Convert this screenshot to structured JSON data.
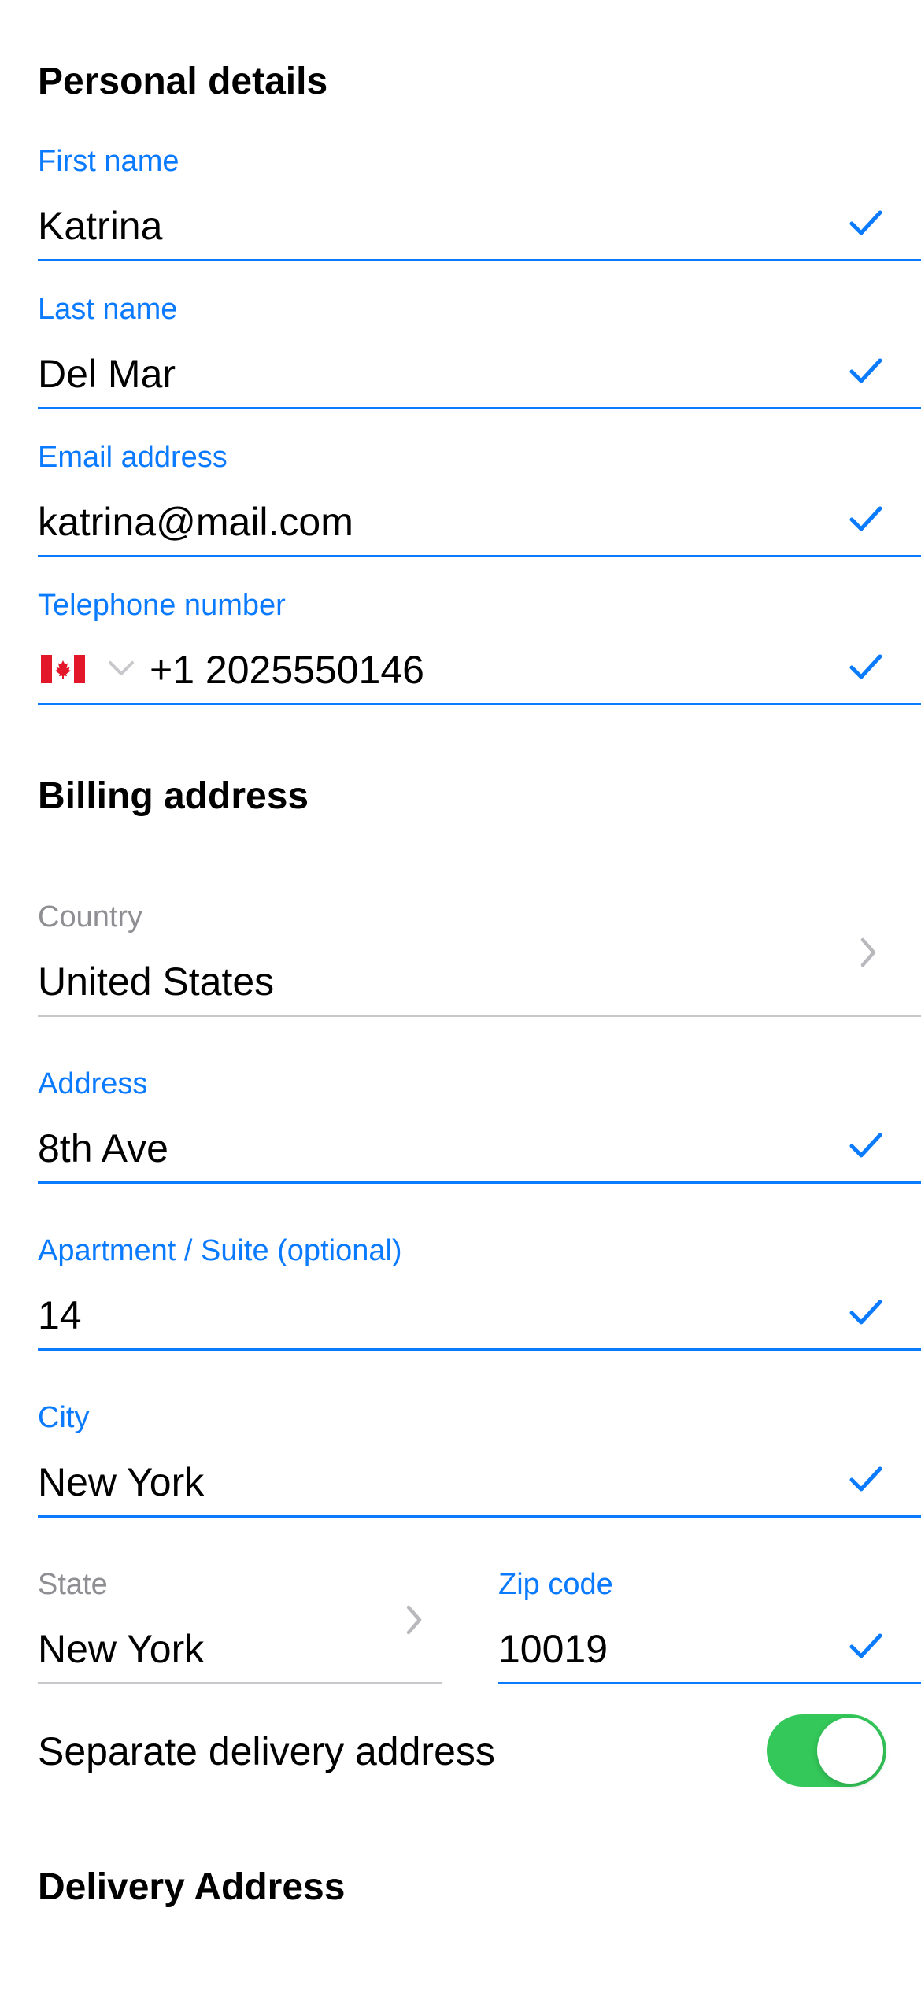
{
  "personal": {
    "title": "Personal details",
    "first_name": {
      "label": "First name",
      "value": "Katrina"
    },
    "last_name": {
      "label": "Last name",
      "value": "Del Mar"
    },
    "email": {
      "label": "Email address",
      "value": "katrina@mail.com"
    },
    "phone": {
      "label": "Telephone number",
      "flag_icon": "canada-flag-icon",
      "value": "+1 2025550146"
    }
  },
  "billing": {
    "title": "Billing address",
    "country": {
      "label": "Country",
      "value": "United States"
    },
    "address": {
      "label": "Address",
      "value": "8th Ave"
    },
    "apartment": {
      "label": "Apartment / Suite (optional)",
      "value": "14"
    },
    "city": {
      "label": "City",
      "value": "New York"
    },
    "state": {
      "label": "State",
      "value": "New York"
    },
    "zip": {
      "label": "Zip code",
      "value": "10019"
    }
  },
  "delivery_toggle": {
    "label": "Separate delivery address",
    "on": true
  },
  "delivery": {
    "title": "Delivery Address"
  },
  "colors": {
    "accent": "#0a7aff",
    "muted_label": "#8e8e93",
    "neutral_line": "#c7c7cc",
    "toggle_on": "#34c759"
  }
}
